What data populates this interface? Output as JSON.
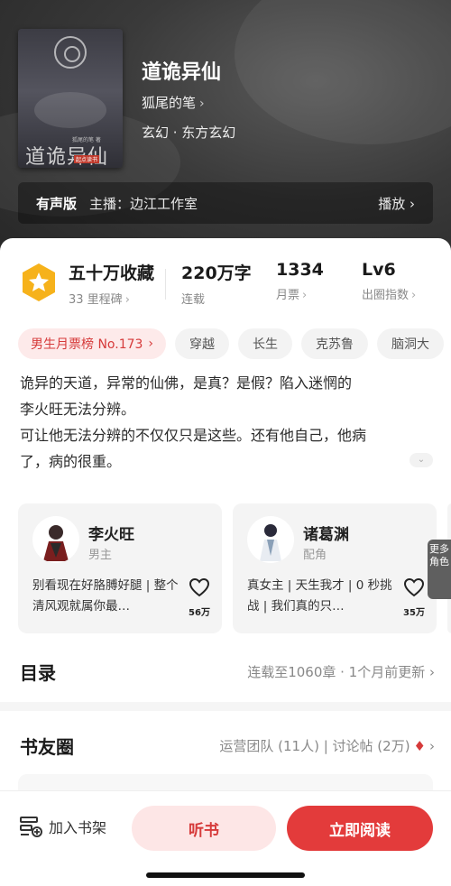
{
  "header": {
    "cover": {
      "title": "道诡异仙",
      "author": "狐尾的笔 著",
      "publisher": "起点读书"
    },
    "title": "道诡异仙",
    "author": "狐尾的笔",
    "genre": "玄幻 · 东方玄幻",
    "audio": {
      "label": "有声版",
      "narrator": "主播：边江工作室",
      "play": "播放"
    }
  },
  "stats": {
    "badge_icon": "star-badge-icon",
    "favorites": {
      "value": "五十万收藏",
      "sub": "33 里程碑"
    },
    "words": {
      "value": "220万字",
      "sub": "连载"
    },
    "monthly": {
      "value": "1334",
      "sub": "月票"
    },
    "level": {
      "value": "Lv6",
      "sub": "出圈指数"
    }
  },
  "tags": {
    "rank": "男生月票榜 No.173",
    "items": [
      "穿越",
      "长生",
      "克苏鲁",
      "脑洞大"
    ]
  },
  "intro": {
    "line1": "诡异的天道，异常的仙佛，是真？是假？陷入迷惘的",
    "line2": "李火旺无法分辨。",
    "line3": "可让他无法分辨的不仅仅只是这些。还有他自己，他病",
    "line4": "了，病的很重。"
  },
  "characters": [
    {
      "name": "李火旺",
      "role": "男主",
      "quote": "别看现在好胳膊好腿 | 整个清风观就属你最…",
      "likes": "56万"
    },
    {
      "name": "诸葛渊",
      "role": "配角",
      "quote": "真女主 | 天生我才 | 0 秒挑战 | 我们真的只…",
      "likes": "35万"
    }
  ],
  "more_roles": "更多角色",
  "catalog": {
    "title": "目录",
    "status": "连载至1060章 · 1个月前更新"
  },
  "circle": {
    "title": "书友圈",
    "team": "运营团队 (11人) | 讨论帖 (2万)"
  },
  "bottom": {
    "shelf": "加入书架",
    "listen": "听书",
    "read": "立即阅读"
  },
  "colors": {
    "accent": "#e33b3b",
    "accent_soft": "#fde6e6",
    "badge": "#f6b21b"
  }
}
